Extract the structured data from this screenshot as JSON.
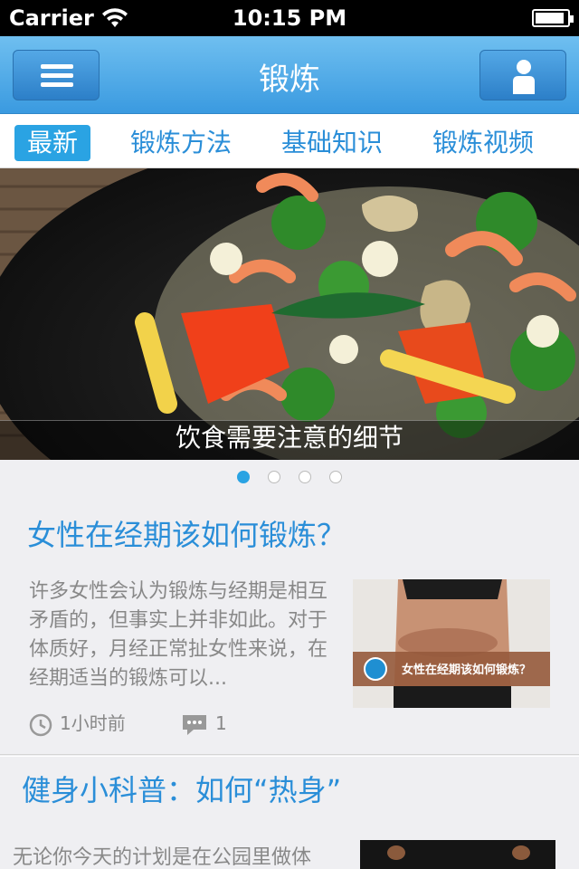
{
  "status_bar": {
    "carrier": "Carrier",
    "time": "10:15 PM",
    "battery_level": 0.9
  },
  "nav": {
    "title": "锻炼",
    "menu_icon": "hamburger-menu-icon",
    "user_icon": "user-profile-icon"
  },
  "tabs": [
    {
      "label": "最新",
      "active": true
    },
    {
      "label": "锻炼方法",
      "active": false
    },
    {
      "label": "基础知识",
      "active": false
    },
    {
      "label": "锻炼视频",
      "active": false
    }
  ],
  "banner": {
    "caption": "饮食需要注意的细节",
    "slide_count": 4,
    "active_slide": 1
  },
  "articles": [
    {
      "title": "女性在经期该如何锻炼？",
      "summary": "许多女性会认为锻炼与经期是相互矛盾的，但事实上并非如此。对于体质好，月经正常扯女性来说，在经期适当的锻炼可以...",
      "thumb_caption": "女性在经期该如何锻炼？",
      "time": "1小时前",
      "comments": "1"
    },
    {
      "title": "健身小科普：如何“热身”",
      "summary": "无论你今天的计划是在公园里做体"
    }
  ],
  "colors": {
    "accent": "#2a8ed8",
    "nav_bg": "#3a9ae0",
    "active_tab": "#2aa3e3"
  }
}
